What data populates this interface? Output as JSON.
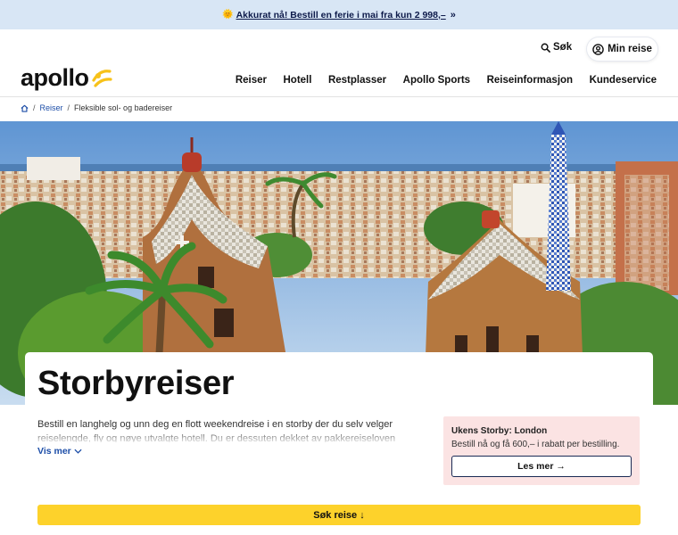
{
  "promo_banner": {
    "emoji": "🌞",
    "link_text": "Akkurat nå! Bestill en ferie i mai fra kun 2 998,–",
    "arrow": "»"
  },
  "header": {
    "logo_text": "apollo",
    "search_label": "Søk",
    "my_trip_label": "Min reise",
    "nav": [
      "Reiser",
      "Hotell",
      "Restplasser",
      "Apollo Sports",
      "Reiseinformasjon",
      "Kundeservice"
    ]
  },
  "breadcrumb": {
    "items": [
      "Reiser",
      "Fleksible sol- og badereiser"
    ],
    "separator": "/"
  },
  "main": {
    "title": "Storbyreiser",
    "description": "Bestill en langhelg og unn deg en flott weekendreise i en storby der du selv velger reiselengde, fly og nøye utvalgte hotell. Du er dessuten dekket av pakkereiseloven når du",
    "show_more": "Vis mer"
  },
  "promo_box": {
    "title": "Ukens Storby: London",
    "description": "Bestill nå og få 600,– i rabatt per bestilling.",
    "button": "Les mer →"
  },
  "cta": {
    "label": "Søk reise ↓"
  },
  "colors": {
    "accent_yellow": "#fdd22b",
    "link_blue": "#1d4ea8",
    "promo_bg": "#d8e6f5",
    "pink_box": "#fbe3e3"
  },
  "icons": {
    "search": "search-icon",
    "user": "user-circle-icon",
    "home": "home-icon",
    "chevron": "chevron-down-icon"
  }
}
